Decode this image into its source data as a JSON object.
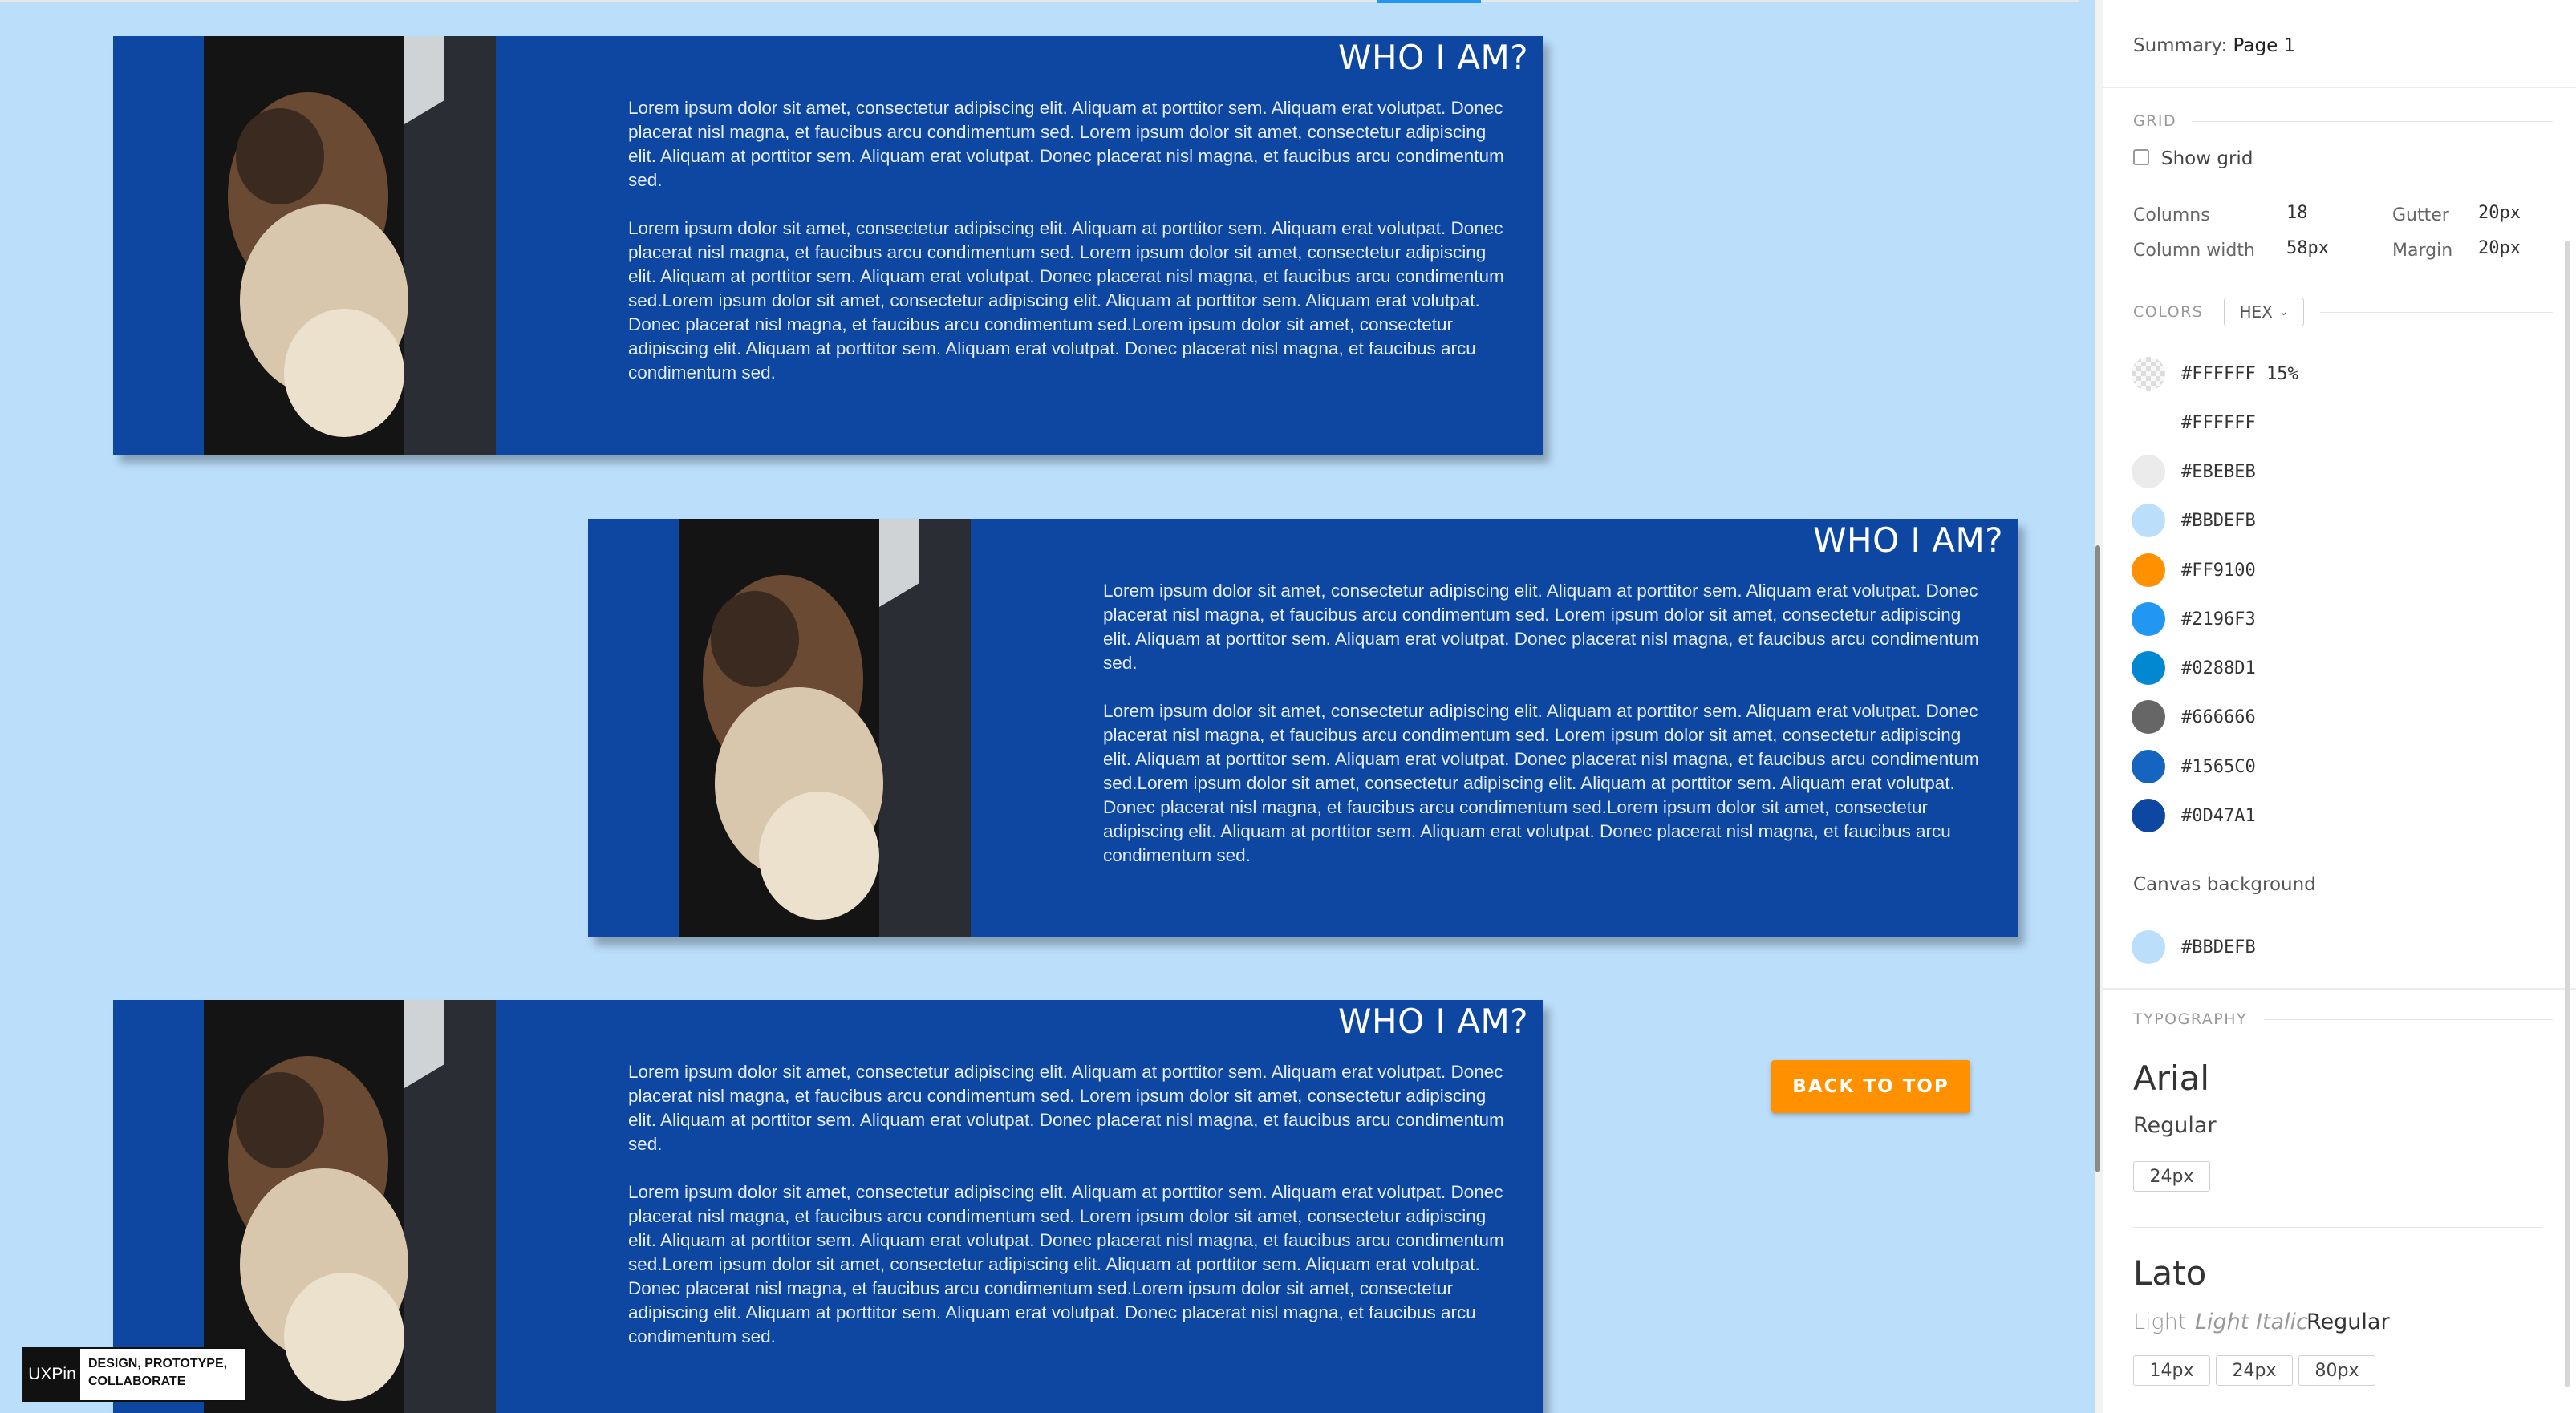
{
  "canvas": {
    "cards": [
      {
        "title": "WHO I AM?",
        "paragraph1": "Lorem ipsum dolor sit amet, consectetur adipiscing elit. Aliquam at porttitor sem.  Aliquam erat volutpat. Donec placerat nisl magna, et faucibus arcu condimentum sed. Lorem ipsum dolor sit amet, consectetur adipiscing elit. Aliquam at porttitor sem.  Aliquam erat volutpat. Donec placerat nisl magna, et faucibus arcu condimentum sed.",
        "paragraph2": "Lorem ipsum dolor sit amet, consectetur adipiscing elit. Aliquam at porttitor sem.  Aliquam erat volutpat. Donec placerat nisl magna, et faucibus arcu condimentum sed. Lorem ipsum dolor sit amet, consectetur adipiscing elit. Aliquam at porttitor sem.  Aliquam erat volutpat. Donec placerat nisl magna, et faucibus arcu condimentum sed.Lorem ipsum dolor sit amet, consectetur adipiscing elit. Aliquam at porttitor sem.  Aliquam erat volutpat. Donec placerat nisl magna, et faucibus arcu condimentum sed.Lorem ipsum dolor sit amet, consectetur adipiscing elit. Aliquam at porttitor sem.  Aliquam erat volutpat. Donec placerat nisl magna, et faucibus arcu condimentum sed."
      },
      {
        "title": "WHO I AM?",
        "paragraph1": "Lorem ipsum dolor sit amet, consectetur adipiscing elit. Aliquam at porttitor sem.  Aliquam erat volutpat. Donec placerat nisl magna, et faucibus arcu condimentum sed. Lorem ipsum dolor sit amet, consectetur adipiscing elit. Aliquam at porttitor sem.  Aliquam erat volutpat. Donec placerat nisl magna, et faucibus arcu condimentum sed.",
        "paragraph2": "Lorem ipsum dolor sit amet, consectetur adipiscing elit. Aliquam at porttitor sem.  Aliquam erat volutpat. Donec placerat nisl magna, et faucibus arcu condimentum sed. Lorem ipsum dolor sit amet, consectetur adipiscing elit. Aliquam at porttitor sem.  Aliquam erat volutpat. Donec placerat nisl magna, et faucibus arcu condimentum sed.Lorem ipsum dolor sit amet, consectetur adipiscing elit. Aliquam at porttitor sem.  Aliquam erat volutpat. Donec placerat nisl magna, et faucibus arcu condimentum sed.Lorem ipsum dolor sit amet, consectetur adipiscing elit. Aliquam at porttitor sem.  Aliquam erat volutpat. Donec placerat nisl magna, et faucibus arcu condimentum sed."
      },
      {
        "title": "WHO I AM?",
        "paragraph1": "Lorem ipsum dolor sit amet, consectetur adipiscing elit. Aliquam at porttitor sem.  Aliquam erat volutpat. Donec placerat nisl magna, et faucibus arcu condimentum sed. Lorem ipsum dolor sit amet, consectetur adipiscing elit. Aliquam at porttitor sem.  Aliquam erat volutpat. Donec placerat nisl magna, et faucibus arcu condimentum sed.",
        "paragraph2": "Lorem ipsum dolor sit amet, consectetur adipiscing elit. Aliquam at porttitor sem.  Aliquam erat volutpat. Donec placerat nisl magna, et faucibus arcu condimentum sed. Lorem ipsum dolor sit amet, consectetur adipiscing elit. Aliquam at porttitor sem.  Aliquam erat volutpat. Donec placerat nisl magna, et faucibus arcu condimentum sed.Lorem ipsum dolor sit amet, consectetur adipiscing elit. Aliquam at porttitor sem.  Aliquam erat volutpat. Donec placerat nisl magna, et faucibus arcu condimentum sed.Lorem ipsum dolor sit amet, consectetur adipiscing elit. Aliquam at porttitor sem.  Aliquam erat volutpat. Donec placerat nisl magna, et faucibus arcu condimentum sed."
      }
    ],
    "back_to_top_label": "BACK TO TOP",
    "brand_logo_text": "UXPin",
    "brand_tagline_line1": "DESIGN, PROTOTYPE,",
    "brand_tagline_line2": "COLLABORATE"
  },
  "panel": {
    "summary_label": "Summary:",
    "summary_page": "Page 1",
    "grid_label": "GRID",
    "show_grid_label": "Show grid",
    "columns_label": "Columns",
    "columns_value": "18",
    "gutter_label": "Gutter",
    "gutter_value": "20px",
    "column_width_label": "Column width",
    "column_width_value": "58px",
    "margin_label": "Margin",
    "margin_value": "20px",
    "colors_label": "COLORS",
    "color_format": "HEX",
    "swatches": [
      {
        "label": "#FFFFFF 15%",
        "color": "#FFFFFF",
        "transparent": true
      },
      {
        "label": "#FFFFFF",
        "color": "#FFFFFF"
      },
      {
        "label": "#EBEBEB",
        "color": "#EBEBEB"
      },
      {
        "label": "#BBDEFB",
        "color": "#BBDEFB"
      },
      {
        "label": "#FF9100",
        "color": "#FF9100"
      },
      {
        "label": "#2196F3",
        "color": "#2196F3"
      },
      {
        "label": "#0288D1",
        "color": "#0288D1"
      },
      {
        "label": "#666666",
        "color": "#666666"
      },
      {
        "label": "#1565C0",
        "color": "#1565C0"
      },
      {
        "label": "#0D47A1",
        "color": "#0D47A1"
      }
    ],
    "canvas_bg_label": "Canvas background",
    "canvas_bg_value": "#BBDEFB",
    "typography_label": "TYPOGRAPHY",
    "font1_name": "Arial",
    "font1_weight": "Regular",
    "font1_size": "24px",
    "font2_name": "Lato",
    "font2_light": "Light",
    "font2_light_italic": "Light Italic",
    "font2_regular": "Regular",
    "font2_sizes": [
      "14px",
      "24px",
      "80px"
    ]
  }
}
